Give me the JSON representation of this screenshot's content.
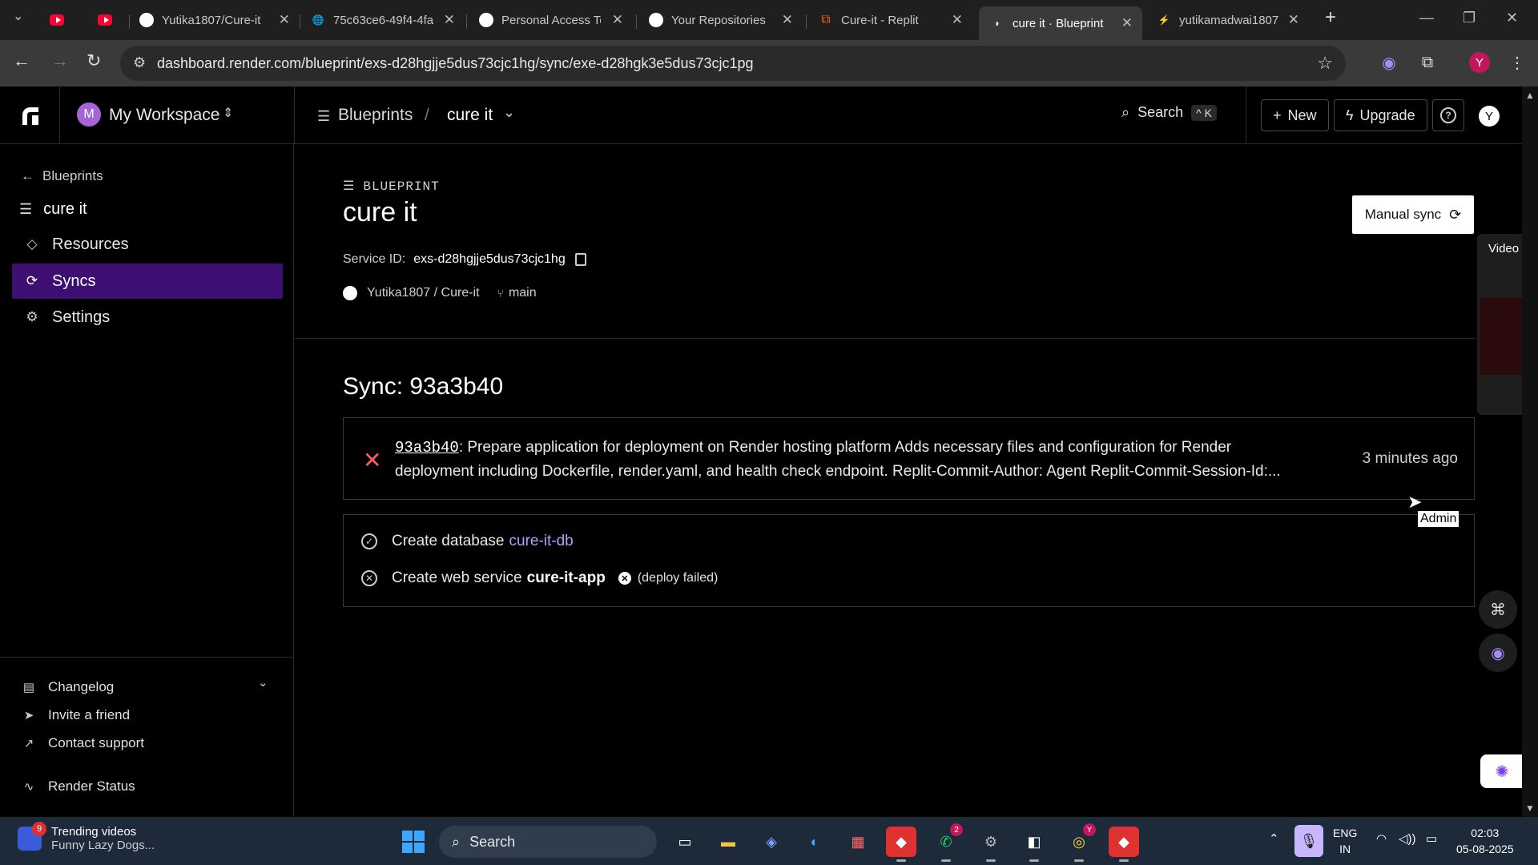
{
  "browser": {
    "tabs": [
      {
        "title": "",
        "icon": "youtube-icon"
      },
      {
        "title": "",
        "icon": "youtube-icon"
      },
      {
        "title": "Yutika1807/Cure-it",
        "icon": "github-icon"
      },
      {
        "title": "75c63ce6-49f4-4fa",
        "icon": "globe-icon"
      },
      {
        "title": "Personal Access To",
        "icon": "github-icon"
      },
      {
        "title": "Your Repositories",
        "icon": "github-icon"
      },
      {
        "title": "Cure-it - Replit",
        "icon": "replit-icon"
      },
      {
        "title": "cure it · Blueprint",
        "icon": "render-icon"
      },
      {
        "title": "yutikamadwai1807",
        "icon": "render-icon"
      }
    ],
    "url": "dashboard.render.com/blueprint/exs-d28hgjje5dus73cjc1hg/sync/exe-d28hgk3e5dus73cjc1pg",
    "profile_initial": "Y"
  },
  "topbar": {
    "workspace_initial": "M",
    "workspace_name": "My Workspace",
    "breadcrumb_root": "Blueprints",
    "breadcrumb_sep": "/",
    "breadcrumb_current": "cure it",
    "search_label": "Search",
    "search_shortcut": "^ K",
    "new_label": "New",
    "upgrade_label": "Upgrade",
    "user_initial": "Y"
  },
  "sidebar": {
    "back_label": "Blueprints",
    "title": "cure it",
    "items": [
      {
        "label": "Resources"
      },
      {
        "label": "Syncs"
      },
      {
        "label": "Settings"
      }
    ],
    "footer": [
      {
        "label": "Changelog"
      },
      {
        "label": "Invite a friend"
      },
      {
        "label": "Contact support"
      },
      {
        "label": "Render Status"
      }
    ]
  },
  "main": {
    "eyebrow": "BLUEPRINT",
    "title": "cure it",
    "manual_sync_label": "Manual sync",
    "service_id_label": "Service ID:",
    "service_id_value": "exs-d28hgjje5dus73cjc1hg",
    "repo": "Yutika1807 / Cure-it",
    "branch": "main",
    "sync_title": "Sync: 93a3b40",
    "commit": {
      "hash": "93a3b40",
      "message": ": Prepare application for deployment on Render hosting platform Adds necessary files and configuration for Render deployment including Dockerfile, render.yaml, and health check endpoint. Replit-Commit-Author: Agent Replit-Commit-Session-Id:...",
      "time": "3 minutes ago"
    },
    "steps": [
      {
        "prefix": "Create database",
        "name": "cure-it-db",
        "status": "success"
      },
      {
        "prefix": "Create web service",
        "name": "cure-it-app",
        "status": "failed",
        "badge": "(deploy failed)"
      }
    ]
  },
  "overlays": {
    "tooltip": "Admin",
    "video_call_label": "Video cal"
  },
  "taskbar": {
    "news_badge": "9",
    "news_title": "Trending videos",
    "news_subtitle": "Funny Lazy Dogs...",
    "search_label": "Search",
    "whatsapp_badge": "2",
    "chrome_badge": "Y",
    "lang_line1": "ENG",
    "lang_line2": "IN",
    "time": "02:03",
    "date": "05-08-2025"
  }
}
